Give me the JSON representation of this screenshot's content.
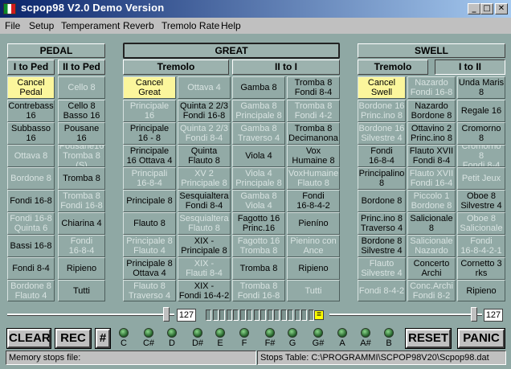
{
  "window": {
    "title": "scpop98  V2.0 Demo Version"
  },
  "menu": [
    "File",
    "Setup",
    "Temperament",
    "Reverb",
    "Tremolo Rate",
    "Help"
  ],
  "pedal": {
    "header": "PEDAL",
    "subs": [
      "I to Ped",
      "II to Ped"
    ],
    "stops": [
      {
        "label": "Cancel\nPedal",
        "state": "on"
      },
      {
        "label": "Cello 8",
        "state": "off"
      },
      {
        "label": "Contrebass\n16",
        "state": "normal"
      },
      {
        "label": "Cello 8\nBasso 16",
        "state": "normal"
      },
      {
        "label": "Subbasso\n16",
        "state": "normal"
      },
      {
        "label": "Pousane\n16",
        "state": "normal"
      },
      {
        "label": "Ottava 8",
        "state": "off"
      },
      {
        "label": "Pousane16\nTromba 8\n(S)",
        "state": "off"
      },
      {
        "label": "Bordone 8",
        "state": "off"
      },
      {
        "label": "Tromba 8",
        "state": "normal"
      },
      {
        "label": "Fondi 16-8",
        "state": "normal"
      },
      {
        "label": "Tromba 8\nFondi 16-8",
        "state": "off"
      },
      {
        "label": "Fondi 16-8\nQuinta 6",
        "state": "off"
      },
      {
        "label": "Chiarina 4",
        "state": "normal"
      },
      {
        "label": "Bassi 16-8",
        "state": "normal"
      },
      {
        "label": "Fondi\n16-8-4",
        "state": "off"
      },
      {
        "label": "Fondi 8-4",
        "state": "normal"
      },
      {
        "label": "Ripieno",
        "state": "normal"
      },
      {
        "label": "Bordone 8\nFlauto 4",
        "state": "off"
      },
      {
        "label": "Tutti",
        "state": "normal"
      }
    ]
  },
  "great": {
    "header": "GREAT",
    "subs": [
      "Tremolo",
      "II to I"
    ],
    "stops": [
      {
        "label": "Cancel\nGreat",
        "state": "on"
      },
      {
        "label": "Ottava 4",
        "state": "off"
      },
      {
        "label": "Gamba 8",
        "state": "normal"
      },
      {
        "label": "Tromba 8\nFondi 8-4",
        "state": "normal"
      },
      {
        "label": "Principale\n16",
        "state": "off"
      },
      {
        "label": "Quinta 2 2/3\nFondi 16-8",
        "state": "normal"
      },
      {
        "label": "Gamba 8\nPrincipale 8",
        "state": "off"
      },
      {
        "label": "Tromba 8\nFondi 4-2",
        "state": "off"
      },
      {
        "label": "Principale\n16 - 8",
        "state": "normal"
      },
      {
        "label": "Quinta 2 2/3\nFondi 8-4",
        "state": "off"
      },
      {
        "label": "Gamba 8\nTraverso 4",
        "state": "off"
      },
      {
        "label": "Tromba 8\nDecimanona",
        "state": "normal"
      },
      {
        "label": "Principale\n16 Ottava 4",
        "state": "normal"
      },
      {
        "label": "Quinta\nFlauto 8",
        "state": "normal"
      },
      {
        "label": "Viola 4",
        "state": "normal"
      },
      {
        "label": "Vox\nHumaine 8",
        "state": "normal"
      },
      {
        "label": "Principali\n16-8-4",
        "state": "off"
      },
      {
        "label": "XV 2\nPrincipale 8",
        "state": "off"
      },
      {
        "label": "Viola 4\nPrincipale 8",
        "state": "off"
      },
      {
        "label": "VoxHumaine\nFlauto 8",
        "state": "off"
      },
      {
        "label": "Principale 8",
        "state": "normal"
      },
      {
        "label": "Sesquialtera\nFondi 8-4",
        "state": "normal"
      },
      {
        "label": "Gamba 8\nViola 4",
        "state": "off"
      },
      {
        "label": "Fondi\n16-8-4-2",
        "state": "normal"
      },
      {
        "label": "Flauto 8",
        "state": "normal"
      },
      {
        "label": "Sesquialtera\nFlauto 8",
        "state": "off"
      },
      {
        "label": "Fagotto 16\nPrinc.16",
        "state": "normal"
      },
      {
        "label": "Pieníno",
        "state": "normal"
      },
      {
        "label": "Principale 8\nFlauto 4",
        "state": "off"
      },
      {
        "label": "XIX -\nPrincipale 8",
        "state": "normal"
      },
      {
        "label": "Fagotto 16\nTromba 8",
        "state": "off"
      },
      {
        "label": "Pienino con\nAnce",
        "state": "off"
      },
      {
        "label": "Principale 8\nOttava 4",
        "state": "normal"
      },
      {
        "label": "XIX -\nFlauti 8-4",
        "state": "off"
      },
      {
        "label": "Tromba 8",
        "state": "normal"
      },
      {
        "label": "Ripieno",
        "state": "normal"
      },
      {
        "label": "Flauto 8\nTraverso 4",
        "state": "off"
      },
      {
        "label": "XIX -\nFondi 16-4-2",
        "state": "normal"
      },
      {
        "label": "Tromba 8\nFondi 16-8",
        "state": "off"
      },
      {
        "label": "Tutti",
        "state": "off"
      }
    ]
  },
  "swell": {
    "header": "SWELL",
    "subs": [
      "Tremolo",
      "I to II"
    ],
    "stops": [
      {
        "label": "Cancel\nSwell",
        "state": "on"
      },
      {
        "label": "Nazardo\nFondi 16-8",
        "state": "off"
      },
      {
        "label": "Unda Maris\n8",
        "state": "normal"
      },
      {
        "label": "Bordone 16\nPrinc.ino 8",
        "state": "off"
      },
      {
        "label": "Nazardo\nBordone 8",
        "state": "normal"
      },
      {
        "label": "Regale 16",
        "state": "normal"
      },
      {
        "label": "Bordone 16\nSilvestre 4",
        "state": "off"
      },
      {
        "label": "Ottavino 2\nPrinc.ino 8",
        "state": "normal"
      },
      {
        "label": "Cromorno 8",
        "state": "normal"
      },
      {
        "label": "Fondi\n16-8-4",
        "state": "normal"
      },
      {
        "label": "Flauto XVII\nFondi 8-4",
        "state": "normal"
      },
      {
        "label": "Cromorno 8\nFondi 8-4",
        "state": "off"
      },
      {
        "label": "Principalino\n8",
        "state": "normal"
      },
      {
        "label": "Flauto XVII\nFondi 16-4",
        "state": "off"
      },
      {
        "label": "Petit Jeux",
        "state": "off"
      },
      {
        "label": "Bordone 8",
        "state": "normal"
      },
      {
        "label": "Piccolo 1\nBordone 8",
        "state": "off"
      },
      {
        "label": "Oboe 8\nSilvestre 4",
        "state": "normal"
      },
      {
        "label": "Princ.ino 8\nTraverso 4",
        "state": "normal"
      },
      {
        "label": "Salicionale\n8",
        "state": "normal"
      },
      {
        "label": "Oboe 8\nSalicionale",
        "state": "off"
      },
      {
        "label": "Bordone 8\nSilvestre 4",
        "state": "normal"
      },
      {
        "label": "Salicionale\nNazardo",
        "state": "off"
      },
      {
        "label": "Fondi\n16-8-4-2-1",
        "state": "off"
      },
      {
        "label": "Flauto\nSilvestre 4",
        "state": "off"
      },
      {
        "label": "Concerto\nArchi",
        "state": "normal"
      },
      {
        "label": "Cornetto 3\nrks",
        "state": "normal"
      },
      {
        "label": "Fondi 8-4-2",
        "state": "off"
      },
      {
        "label": "Conc.Archi\nFondi 8-2",
        "state": "off"
      },
      {
        "label": "Ripieno",
        "state": "normal"
      }
    ]
  },
  "controls": {
    "left_value": "127",
    "right_value": "127",
    "eq_symbol": "=",
    "left_slider_level": 127,
    "right_slider_level": 127,
    "clear": "CLEAR",
    "rec": "REC",
    "hash": "#",
    "reset": "RESET",
    "panic": "PANIC",
    "notes": [
      "C",
      "C#",
      "D",
      "D#",
      "E",
      "F",
      "F#",
      "G",
      "G#",
      "A",
      "A#",
      "B"
    ]
  },
  "status": {
    "memory": "Memory stops file:",
    "table": "Stops Table: C:\\PROGRAMMI\\SCPOP98V20\\Scpop98.dat"
  }
}
